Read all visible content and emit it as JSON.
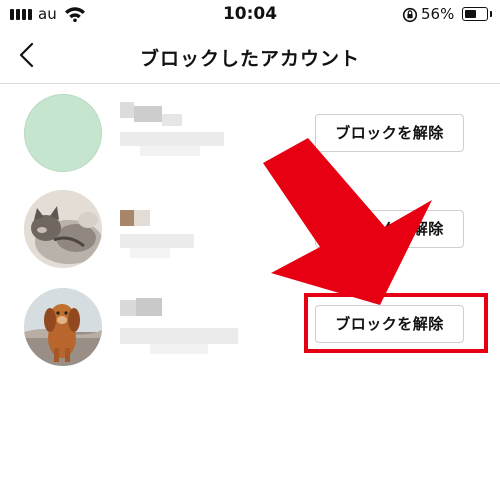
{
  "status_bar": {
    "carrier": "au",
    "time": "10:04",
    "battery_percent": "56%",
    "battery_level": 0.56
  },
  "header": {
    "back_icon": "chevron-left-icon",
    "title": "ブロックしたアカウント"
  },
  "blocked_accounts": [
    {
      "avatar": "plain-green-avatar",
      "avatar_color": "#c5e5cf",
      "unblock_label": "ブロックを解除"
    },
    {
      "avatar": "cat-photo-avatar",
      "unblock_label": "ブロックを解除"
    },
    {
      "avatar": "dog-photo-avatar",
      "unblock_label": "ブロックを解除"
    }
  ],
  "annotation": {
    "arrow_color": "#e60012",
    "highlight_color": "#e60012"
  }
}
